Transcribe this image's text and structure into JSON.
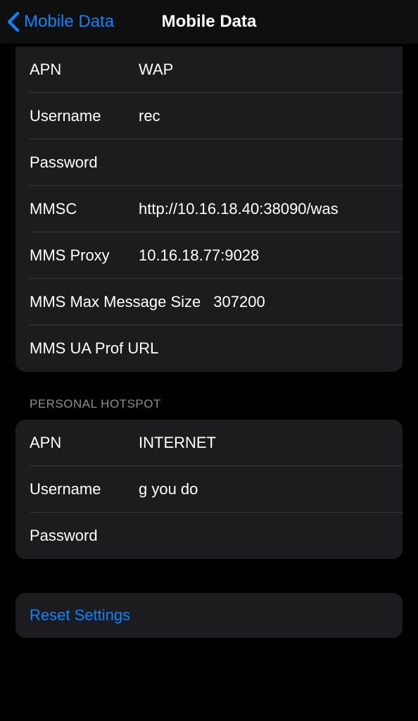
{
  "nav": {
    "back_label": "Mobile Data",
    "title": "Mobile Data"
  },
  "mms_section": {
    "apn_label": "APN",
    "apn_value": "WAP",
    "username_label": "Username",
    "username_value": "rec",
    "password_label": "Password",
    "password_value": "",
    "mmsc_label": "MMSC",
    "mmsc_value": "http://10.16.18.40:38090/was",
    "mms_proxy_label": "MMS Proxy",
    "mms_proxy_value": "10.16.18.77:9028",
    "mms_max_label": "MMS Max Message Size",
    "mms_max_value": "307200",
    "mms_ua_label": "MMS UA Prof URL",
    "mms_ua_value": ""
  },
  "hotspot_section": {
    "header": "Personal Hotspot",
    "apn_label": "APN",
    "apn_value": "INTERNET",
    "username_label": "Username",
    "username_value": "g you do",
    "password_label": "Password",
    "password_value": ""
  },
  "reset": {
    "label": "Reset Settings"
  }
}
